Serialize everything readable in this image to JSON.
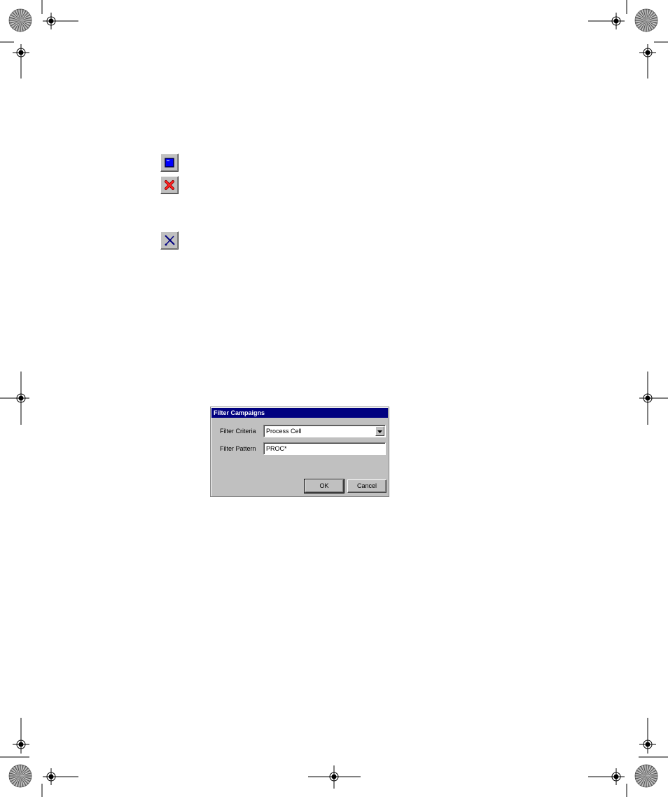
{
  "toolbar_icons": [
    {
      "name": "stop",
      "icon": "stop-icon",
      "color": "#0000ff"
    },
    {
      "name": "abort",
      "icon": "abort-icon",
      "color": "#ff0000"
    },
    {
      "name": "clear",
      "icon": "clear-icon",
      "color": "#000080"
    }
  ],
  "dialog": {
    "title": "Filter Campaigns",
    "criteria_label": "Filter Criteria",
    "criteria_value": "Process Cell",
    "pattern_label": "Filter Pattern",
    "pattern_value": "PROC*",
    "ok_label": "OK",
    "cancel_label": "Cancel"
  },
  "colors": {
    "titlebar": "#000080",
    "window": "#c0c0c0"
  }
}
